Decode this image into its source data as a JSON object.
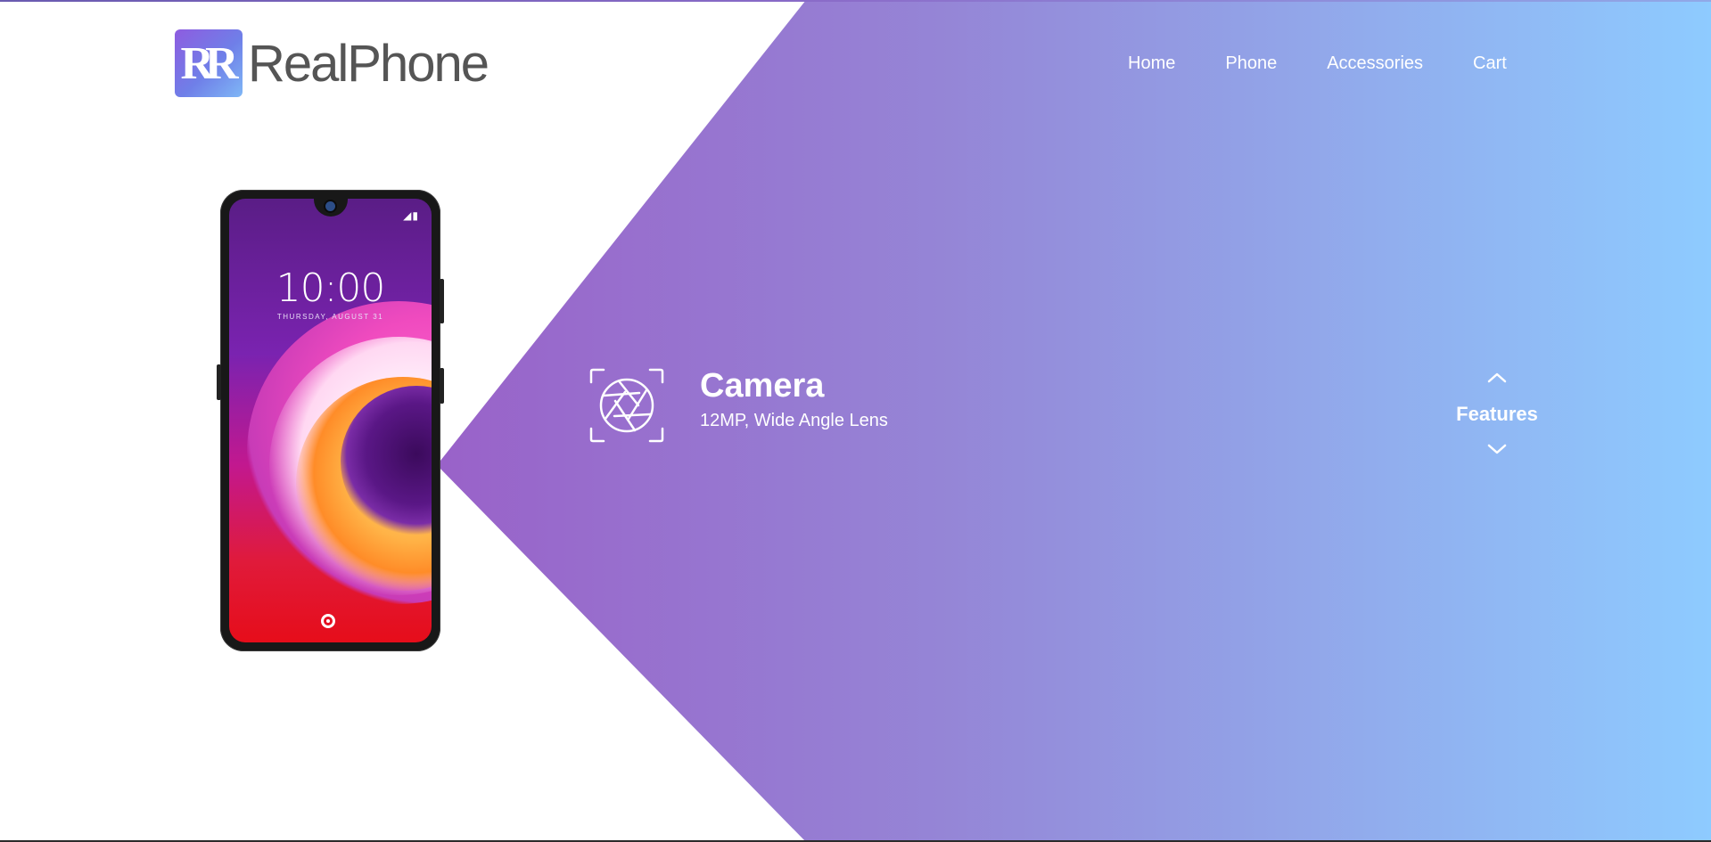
{
  "brand": {
    "logo_mark": "R",
    "name": "RealPhone"
  },
  "nav": {
    "items": [
      {
        "label": "Home"
      },
      {
        "label": "Phone"
      },
      {
        "label": "Accessories"
      },
      {
        "label": "Cart"
      }
    ]
  },
  "phone_preview": {
    "time": "10:00",
    "date": "THURSDAY, AUGUST 31"
  },
  "feature": {
    "icon": "camera-aperture-icon",
    "title": "Camera",
    "description": "12MP, Wide Angle Lens"
  },
  "switcher": {
    "label": "Features",
    "up_icon": "chevron-up-icon",
    "down_icon": "chevron-down-icon"
  },
  "colors": {
    "gradient_start": "#9a5bc6",
    "gradient_mid": "#9585d6",
    "gradient_end": "#8ecbff",
    "logo_text": "#555555"
  }
}
